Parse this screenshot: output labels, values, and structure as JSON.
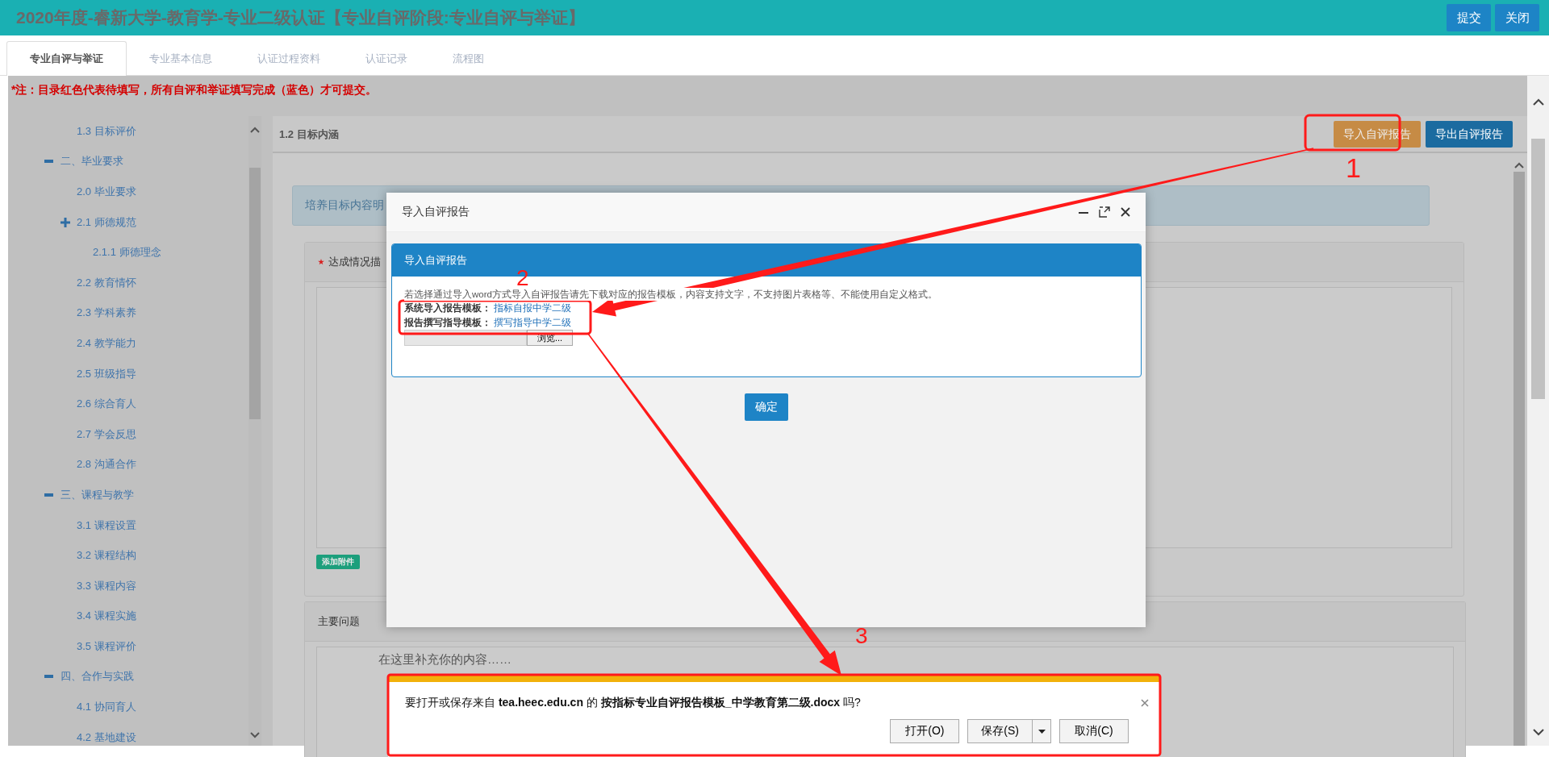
{
  "header": {
    "title": "2020年度-睿新大学-教育学-专业二级认证【专业自评阶段:专业自评与举证】",
    "buttons": [
      {
        "label": "提交"
      },
      {
        "label": "关闭"
      }
    ]
  },
  "tabs": [
    {
      "label": "专业自评与举证",
      "selected": true
    },
    {
      "label": "专业基本信息",
      "selected": false
    },
    {
      "label": "认证过程资料",
      "selected": false
    },
    {
      "label": "认证记录",
      "selected": false
    },
    {
      "label": "流程图",
      "selected": false
    }
  ],
  "notice": "*注：目录红色代表待填写，所有自评和举证填写完成（蓝色）才可提交。",
  "sidebar": {
    "items": [
      {
        "children": [
          {
            "label": "1.3 目标评价"
          }
        ]
      },
      {
        "label": "二、毕业要求",
        "expanded": true,
        "children": [
          {
            "label": "2.0 毕业要求"
          },
          {
            "label": "2.1 师德规范",
            "expanded": false,
            "children": [
              {
                "label": "2.1.1 师德理念"
              }
            ]
          },
          {
            "label": "2.2 教育情怀"
          },
          {
            "label": "2.3 学科素养"
          },
          {
            "label": "2.4 教学能力"
          },
          {
            "label": "2.5 班级指导"
          },
          {
            "label": "2.6 综合育人"
          },
          {
            "label": "2.7 学会反思"
          },
          {
            "label": "2.8 沟通合作"
          }
        ]
      },
      {
        "label": "三、课程与教学",
        "expanded": true,
        "children": [
          {
            "label": "3.1 课程设置"
          },
          {
            "label": "3.2 课程结构"
          },
          {
            "label": "3.3 课程内容"
          },
          {
            "label": "3.4 课程实施"
          },
          {
            "label": "3.5 课程评价"
          }
        ]
      },
      {
        "label": "四、合作与实践",
        "expanded": true,
        "children": [
          {
            "label": "4.1 协同育人"
          },
          {
            "label": "4.2 基地建设"
          }
        ]
      }
    ]
  },
  "section": {
    "title": "1.2 目标内涵",
    "actions": [
      {
        "label": "导入自评报告",
        "kind": "import"
      },
      {
        "label": "导出自评报告",
        "kind": "export"
      }
    ],
    "info": "培养目标内容明",
    "cards": [
      {
        "title": "达成情况描",
        "required": true,
        "attach_button": "添加附件"
      },
      {
        "title": "主要问题",
        "required": false,
        "content": "在这里补充你的内容……"
      }
    ]
  },
  "dialog": {
    "title": "导入自评报告",
    "panel_title": "导入自评报告",
    "instructions": "若选择通过导入word方式导入自评报告请先下载对应的报告模板，内容支持文字，不支持图片表格等、不能使用自定义格式。",
    "templates": [
      {
        "label": "系统导入报告模板：",
        "link": "指标自报中学二级"
      },
      {
        "label": "报告撰写指导模板：",
        "link": "撰写指导中学二级"
      }
    ],
    "browse_button": "浏览...",
    "confirm_button": "确定"
  },
  "download_bar": {
    "message": "要打开或保存来自 **tea.heec.edu.cn** 的 **按指标专业自评报告模板_中学教育第二级.docx** 吗?",
    "buttons": [
      {
        "label": "打开(O)",
        "kind": "plain"
      },
      {
        "label": "保存(S)",
        "kind": "split"
      },
      {
        "label": "取消(C)",
        "kind": "plain"
      }
    ]
  },
  "annotations": [
    {
      "label": "1"
    },
    {
      "label": "2"
    },
    {
      "label": "3"
    }
  ]
}
